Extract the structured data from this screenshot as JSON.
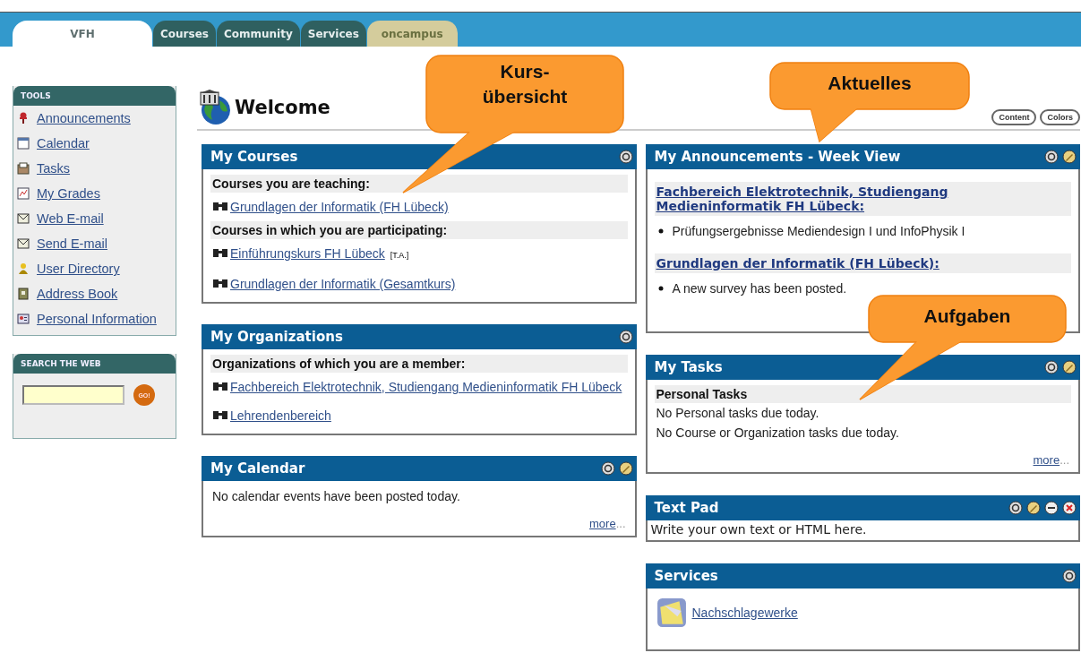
{
  "tabs": [
    {
      "label": "VFH",
      "selected": true,
      "kind": "main"
    },
    {
      "label": "Courses",
      "selected": false,
      "kind": "main"
    },
    {
      "label": "Community",
      "selected": false,
      "kind": "main"
    },
    {
      "label": "Services",
      "selected": false,
      "kind": "main"
    },
    {
      "label": "oncampus",
      "selected": false,
      "kind": "partner"
    }
  ],
  "sidebar": {
    "tools": {
      "title": "TOOLS",
      "items": [
        {
          "label": "Announcements",
          "kind": "pin"
        },
        {
          "label": "Calendar",
          "kind": "calendar"
        },
        {
          "label": "Tasks",
          "kind": "tasks"
        },
        {
          "label": "My Grades",
          "kind": "grades"
        },
        {
          "label": "Web E-mail",
          "kind": "mail"
        },
        {
          "label": "Send E-mail",
          "kind": "mail"
        },
        {
          "label": "User Directory",
          "kind": "users"
        },
        {
          "label": "Address Book",
          "kind": "book"
        },
        {
          "label": "Personal Information",
          "kind": "profile"
        }
      ]
    },
    "search": {
      "title": "SEARCH THE WEB",
      "button": "GO!"
    }
  },
  "welcome": {
    "title": "Welcome"
  },
  "header_buttons": [
    "Content",
    "Colors"
  ],
  "columns": [
    [
      {
        "title": "My Courses",
        "controls": [
          {
            "kind": "refresh"
          }
        ],
        "blocks": [
          {
            "kind": "heading",
            "text": "Courses you are teaching:"
          },
          {
            "kind": "link",
            "text": "Grundlagen der Informatik (FH Lübeck)"
          },
          {
            "kind": "heading",
            "text": "Courses in which you are participating:"
          },
          {
            "kind": "link",
            "text": "Einführungskurs FH Lübeck",
            "suffix": "[T.A.]"
          },
          {
            "kind": "link",
            "text": "Grundlagen der Informatik (Gesamtkurs)"
          }
        ]
      },
      {
        "title": "My Organizations",
        "controls": [
          {
            "kind": "refresh"
          }
        ],
        "blocks": [
          {
            "kind": "heading",
            "text": "Organizations of which you are a member:"
          },
          {
            "kind": "link",
            "text": "Fachbereich Elektrotechnik, Studiengang Medieninformatik FH Lübeck"
          },
          {
            "kind": "link",
            "text": "Lehrendenbereich"
          }
        ]
      },
      {
        "title": "My Calendar",
        "controls": [
          {
            "kind": "refresh"
          },
          {
            "kind": "edit"
          }
        ],
        "blocks": [
          {
            "kind": "text",
            "text": "No calendar events have been posted today."
          },
          {
            "kind": "more",
            "text": "more",
            "trail": "..."
          }
        ]
      }
    ],
    [
      {
        "title": "My Announcements - Week View",
        "controls": [
          {
            "kind": "refresh"
          },
          {
            "kind": "edit"
          }
        ],
        "blocks": [
          {
            "kind": "linkheading",
            "text": "Fachbereich Elektrotechnik, Studiengang Medieninformatik FH Lübeck:"
          },
          {
            "kind": "bullet",
            "text": "Prüfungsergebnisse Mediendesign I und InfoPhysik I"
          },
          {
            "kind": "linkheading",
            "text": "Grundlagen der Informatik (FH Lübeck):"
          },
          {
            "kind": "bullet",
            "text": "A new survey has been posted."
          }
        ]
      },
      {
        "title": "My Tasks",
        "controls": [
          {
            "kind": "refresh"
          },
          {
            "kind": "edit"
          }
        ],
        "blocks": [
          {
            "kind": "heading",
            "text": "Personal Tasks"
          },
          {
            "kind": "text",
            "text": "No Personal tasks due today."
          },
          {
            "kind": "text",
            "text": "No Course or Organization tasks due today."
          },
          {
            "kind": "more",
            "text": "more",
            "trail": "..."
          }
        ]
      },
      {
        "title": "Text Pad",
        "controls": [
          {
            "kind": "refresh"
          },
          {
            "kind": "edit"
          },
          {
            "kind": "minimize"
          },
          {
            "kind": "close"
          }
        ],
        "blocks": [
          {
            "kind": "note",
            "text": "Write your own text or HTML here."
          }
        ]
      },
      {
        "title": "Services",
        "controls": [
          {
            "kind": "refresh"
          }
        ],
        "blocks": [
          {
            "kind": "service",
            "text": "Nachschlagewerke"
          }
        ]
      }
    ]
  ],
  "callouts": [
    {
      "lines": [
        "Kurs-",
        "übersicht"
      ]
    },
    {
      "lines": [
        "Aktuelles"
      ]
    },
    {
      "lines": [
        "Aufgaben"
      ]
    }
  ]
}
